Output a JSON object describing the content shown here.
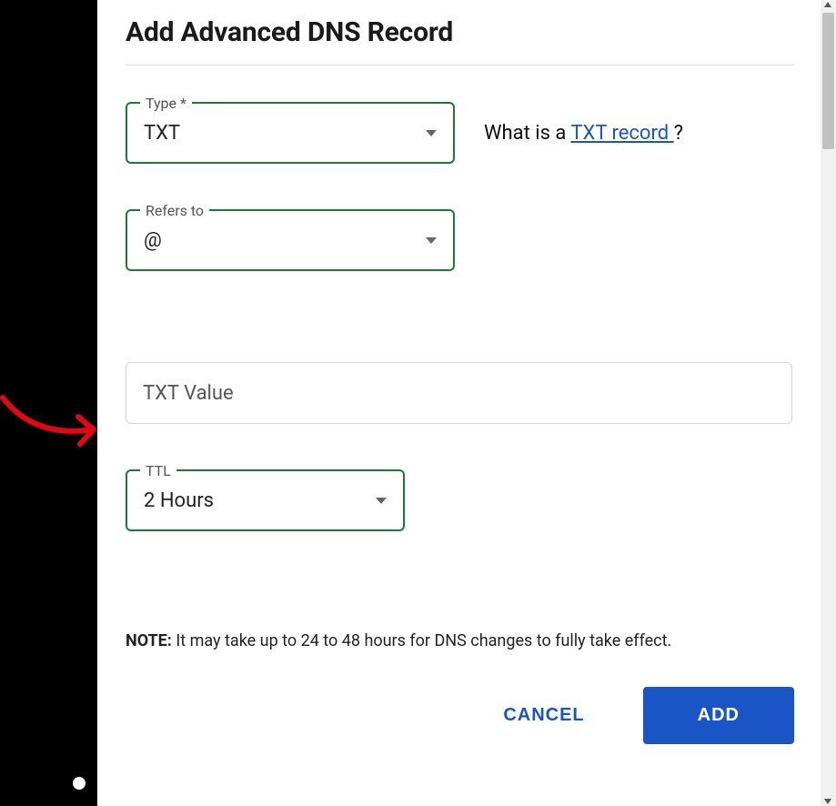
{
  "dialog": {
    "title": "Add Advanced DNS Record"
  },
  "fields": {
    "type": {
      "label": "Type *",
      "value": "TXT"
    },
    "refers_to": {
      "label": "Refers to",
      "value": "@"
    },
    "txt_value": {
      "placeholder": "TXT Value",
      "value": ""
    },
    "ttl": {
      "label": "TTL",
      "value": "2 Hours"
    }
  },
  "help": {
    "prefix": "What is a ",
    "link_text": "TXT record",
    "suffix": "?"
  },
  "note": {
    "label": "NOTE:",
    "text": " It may take up to 24 to 48 hours for DNS changes to fully take effect."
  },
  "buttons": {
    "cancel": "CANCEL",
    "add": "ADD"
  }
}
